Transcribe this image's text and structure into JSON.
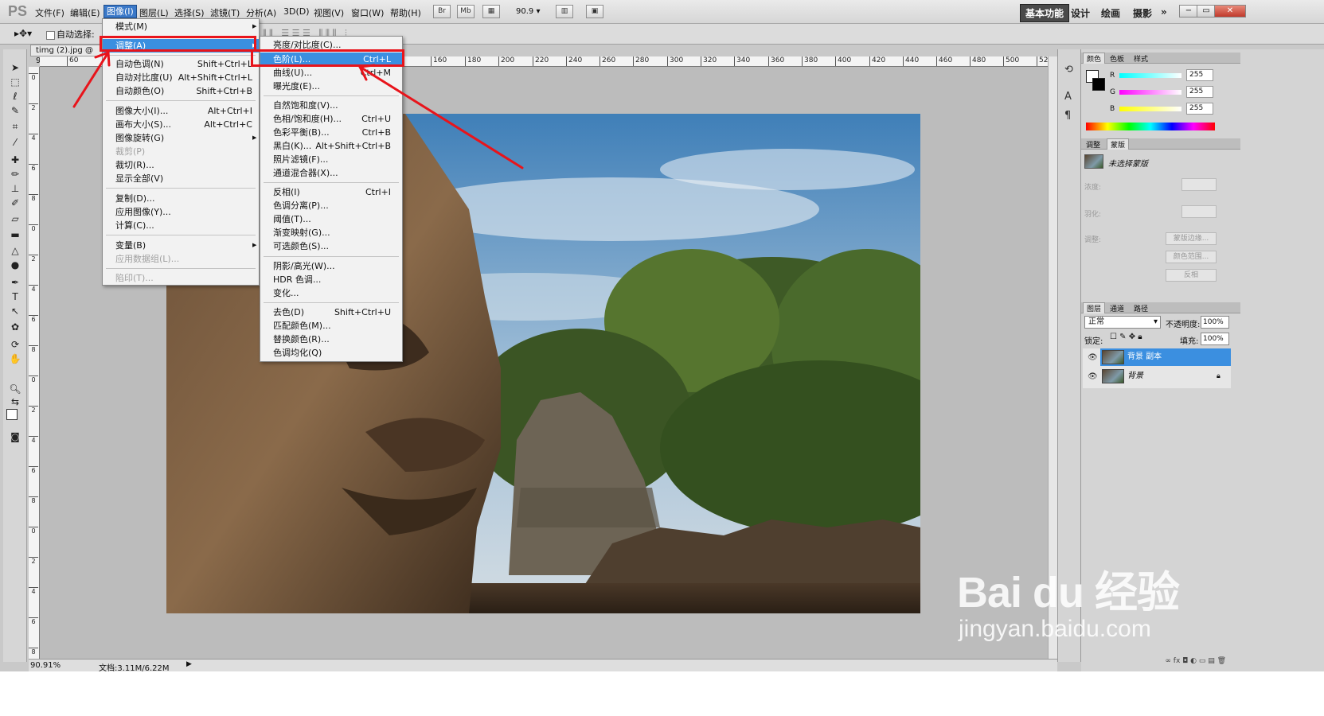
{
  "app": {
    "logo": "PS"
  },
  "menubar": {
    "items": [
      "文件(F)",
      "编辑(E)",
      "图像(I)",
      "图层(L)",
      "选择(S)",
      "滤镜(T)",
      "分析(A)",
      "3D(D)",
      "视图(V)",
      "窗口(W)",
      "帮助(H)"
    ],
    "active_item": "图像(I)",
    "tool_icons": [
      "Br",
      "Mb"
    ],
    "zoom_value": "90.9",
    "workspaces": [
      "基本功能",
      "设计",
      "绘画",
      "摄影",
      "»"
    ],
    "window_controls": [
      "−",
      "▭",
      "✕"
    ]
  },
  "options_bar": {
    "auto_select_label": "自动选择:"
  },
  "document": {
    "tab_title": "timg (2).jpg @ 90.",
    "zoom_percent": "90.91%",
    "doc_size": "文档:3.11M/6.22M",
    "ruler_h_labels": [
      "60",
      "160",
      "180",
      "200",
      "220",
      "240",
      "260",
      "280",
      "300",
      "320",
      "340",
      "360",
      "380",
      "400",
      "420",
      "440",
      "460",
      "480",
      "500",
      "520"
    ],
    "ruler_v_labels": [
      "0",
      "2",
      "4",
      "6",
      "8",
      "0",
      "2",
      "4",
      "6",
      "8",
      "0",
      "2",
      "4",
      "6",
      "8",
      "0",
      "2",
      "4",
      "6",
      "8"
    ]
  },
  "image_menu": {
    "items": [
      {
        "label": "模式(M)",
        "submenu": true
      },
      {
        "label": "调整(A)",
        "submenu": true,
        "highlighted": true
      },
      {
        "label": "自动色调(N)",
        "shortcut": "Shift+Ctrl+L"
      },
      {
        "label": "自动对比度(U)",
        "shortcut": "Alt+Shift+Ctrl+L"
      },
      {
        "label": "自动颜色(O)",
        "shortcut": "Shift+Ctrl+B"
      },
      {
        "label": "图像大小(I)...",
        "shortcut": "Alt+Ctrl+I"
      },
      {
        "label": "画布大小(S)...",
        "shortcut": "Alt+Ctrl+C"
      },
      {
        "label": "图像旋转(G)",
        "submenu": true
      },
      {
        "label": "裁剪(P)",
        "disabled": true
      },
      {
        "label": "裁切(R)..."
      },
      {
        "label": "显示全部(V)"
      },
      {
        "label": "复制(D)..."
      },
      {
        "label": "应用图像(Y)..."
      },
      {
        "label": "计算(C)..."
      },
      {
        "label": "变量(B)",
        "submenu": true
      },
      {
        "label": "应用数据组(L)...",
        "disabled": true
      },
      {
        "label": "陷印(T)...",
        "disabled": true
      }
    ]
  },
  "adjust_menu": {
    "items": [
      {
        "label": "亮度/对比度(C)..."
      },
      {
        "label": "色阶(L)...",
        "shortcut": "Ctrl+L",
        "highlighted": true
      },
      {
        "label": "曲线(U)...",
        "shortcut": "Ctrl+M"
      },
      {
        "label": "曝光度(E)..."
      },
      {
        "label": "自然饱和度(V)..."
      },
      {
        "label": "色相/饱和度(H)...",
        "shortcut": "Ctrl+U"
      },
      {
        "label": "色彩平衡(B)...",
        "shortcut": "Ctrl+B"
      },
      {
        "label": "黑白(K)...",
        "shortcut": "Alt+Shift+Ctrl+B"
      },
      {
        "label": "照片滤镜(F)..."
      },
      {
        "label": "通道混合器(X)..."
      },
      {
        "label": "反相(I)",
        "shortcut": "Ctrl+I"
      },
      {
        "label": "色调分离(P)..."
      },
      {
        "label": "阈值(T)..."
      },
      {
        "label": "渐变映射(G)..."
      },
      {
        "label": "可选颜色(S)..."
      },
      {
        "label": "阴影/高光(W)..."
      },
      {
        "label": "HDR 色调..."
      },
      {
        "label": "变化..."
      },
      {
        "label": "去色(D)",
        "shortcut": "Shift+Ctrl+U"
      },
      {
        "label": "匹配颜色(M)..."
      },
      {
        "label": "替换颜色(R)..."
      },
      {
        "label": "色调均化(Q)"
      }
    ]
  },
  "color_panel": {
    "tabs": [
      "颜色",
      "色板",
      "样式"
    ],
    "channels": [
      {
        "name": "R",
        "value": "255"
      },
      {
        "name": "G",
        "value": "255"
      },
      {
        "name": "B",
        "value": "255"
      }
    ]
  },
  "masks_panel": {
    "tabs": [
      "调整",
      "蒙版"
    ],
    "status": "未选择蒙版",
    "density_label": "浓度:",
    "feather_label": "羽化:",
    "refine_label": "调整:",
    "buttons": [
      "蒙版边缘...",
      "颜色范围...",
      "反相"
    ]
  },
  "layers_panel": {
    "tabs": [
      "图层",
      "通道",
      "路径"
    ],
    "blend_mode": "正常",
    "opacity_label": "不透明度:",
    "opacity": "100%",
    "lock_label": "锁定:",
    "fill_label": "填充:",
    "fill": "100%",
    "layers": [
      {
        "name": "背景 副本",
        "selected": true
      },
      {
        "name": "背景",
        "locked": true
      }
    ]
  },
  "watermark": {
    "brand": "Bai du 经验",
    "url": "jingyan.baidu.com"
  },
  "colors": {
    "highlight": "#3b8fe0",
    "annotation_red": "#e8141b",
    "active_menu": "#3a78c8"
  }
}
